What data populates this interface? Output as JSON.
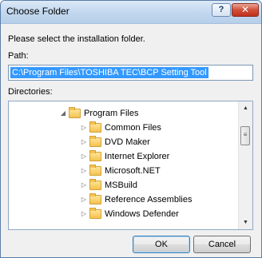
{
  "window": {
    "title": "Choose Folder",
    "help_label": "?",
    "close_label": "✕"
  },
  "prompt": "Please select the installation folder.",
  "path": {
    "label": "Path:",
    "value": "C:\\Program Files\\TOSHIBA TEC\\BCP Setting Tool"
  },
  "directories": {
    "label": "Directories:",
    "parent": {
      "label": "Program Files",
      "expanded": true
    },
    "children": [
      {
        "label": "Common Files"
      },
      {
        "label": "DVD Maker"
      },
      {
        "label": "Internet Explorer"
      },
      {
        "label": "Microsoft.NET"
      },
      {
        "label": "MSBuild"
      },
      {
        "label": "Reference Assemblies"
      },
      {
        "label": "Windows Defender"
      }
    ]
  },
  "buttons": {
    "ok_label": "OK",
    "cancel_label": "Cancel"
  }
}
